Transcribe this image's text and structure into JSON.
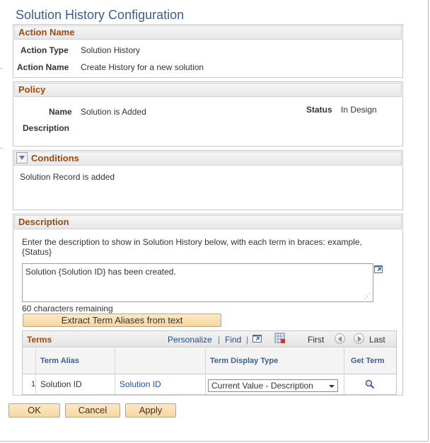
{
  "page": {
    "title": "Solution History Configuration"
  },
  "action_name": {
    "header": "Action Name",
    "action_type_label": "Action Type",
    "action_type_value": "Solution History",
    "action_name_label": "Action Name",
    "action_name_value": "Create History for a new solution"
  },
  "policy": {
    "header": "Policy",
    "name_label": "Name",
    "name_value": "Solution is Added",
    "status_label": "Status",
    "status_value": "In Design",
    "description_label": "Description"
  },
  "conditions": {
    "header": "Conditions",
    "text": "Solution Record is added"
  },
  "description": {
    "header": "Description",
    "instruction_line1": "Enter the description to show in Solution History below, with each term in braces: example,",
    "instruction_line2": "{Status}",
    "textarea_value": "Solution {Solution ID} has been created.",
    "chars_remaining": "60 characters remaining",
    "extract_button": "Extract Term Aliases from text"
  },
  "terms": {
    "title": "Terms",
    "personalize": "Personalize",
    "find": "Find",
    "separator": "|",
    "first": "First",
    "last": "Last",
    "columns": {
      "term_alias": "Term Alias",
      "term_display_type": "Term Display Type",
      "get_term": "Get Term"
    },
    "rows": [
      {
        "num": "1",
        "alias": "Solution ID",
        "term": "Solution ID",
        "display_type": "Current Value - Description"
      }
    ]
  },
  "buttons": {
    "ok": "OK",
    "cancel": "Cancel",
    "apply": "Apply"
  },
  "colors": {
    "title": "#3e5e8e",
    "section_header": "#9c4a0c",
    "link": "#1f4e91",
    "button_bg": "#f8d7a0"
  },
  "icons": [
    "expand-window-icon",
    "download-grid-icon",
    "view-all-icon",
    "prev-icon",
    "next-icon",
    "search-icon",
    "collapse-icon"
  ]
}
